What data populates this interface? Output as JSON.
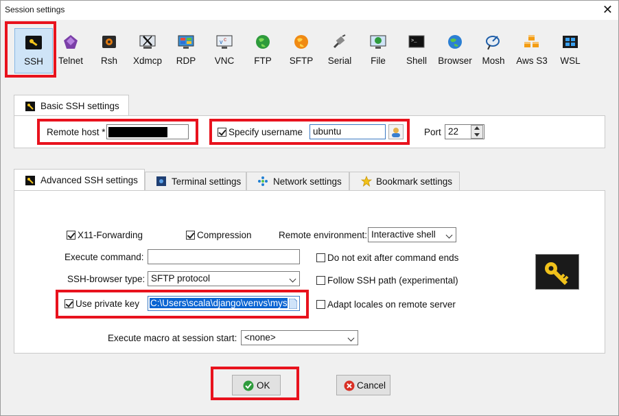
{
  "window": {
    "title": "Session settings",
    "close_glyph": "✕"
  },
  "protocols": [
    {
      "label": "SSH",
      "icon": "ssh-key-icon"
    },
    {
      "label": "Telnet",
      "icon": "telnet-icon"
    },
    {
      "label": "Rsh",
      "icon": "rsh-icon"
    },
    {
      "label": "Xdmcp",
      "icon": "xdmcp-icon"
    },
    {
      "label": "RDP",
      "icon": "rdp-monitor-icon"
    },
    {
      "label": "VNC",
      "icon": "vnc-icon"
    },
    {
      "label": "FTP",
      "icon": "ftp-globe-icon"
    },
    {
      "label": "SFTP",
      "icon": "sftp-globe-icon"
    },
    {
      "label": "Serial",
      "icon": "serial-plug-icon"
    },
    {
      "label": "File",
      "icon": "file-monitor-icon"
    },
    {
      "label": "Shell",
      "icon": "shell-terminal-icon"
    },
    {
      "label": "Browser",
      "icon": "browser-globe-icon"
    },
    {
      "label": "Mosh",
      "icon": "mosh-satellite-icon"
    },
    {
      "label": "Aws S3",
      "icon": "aws-s3-cubes-icon"
    },
    {
      "label": "WSL",
      "icon": "wsl-windows-icon"
    }
  ],
  "basic": {
    "tab_label": "Basic SSH settings",
    "remote_host_label": "Remote host *",
    "remote_host_value": "",
    "specify_username_label": "Specify username",
    "specify_username_checked": true,
    "username_value": "ubuntu",
    "port_label": "Port",
    "port_value": "22"
  },
  "tabs": [
    {
      "label": "Advanced SSH settings",
      "icon": "key-icon",
      "active": true
    },
    {
      "label": "Terminal settings",
      "icon": "terminal-icon",
      "active": false
    },
    {
      "label": "Network settings",
      "icon": "network-icon",
      "active": false
    },
    {
      "label": "Bookmark settings",
      "icon": "star-icon",
      "active": false
    }
  ],
  "advanced": {
    "x11_label": "X11-Forwarding",
    "x11_checked": true,
    "compression_label": "Compression",
    "compression_checked": true,
    "remote_env_label": "Remote environment:",
    "remote_env_value": "Interactive shell",
    "execute_command_label": "Execute command:",
    "execute_command_value": "",
    "do_not_exit_label": "Do not exit after command ends",
    "do_not_exit_checked": false,
    "browser_type_label": "SSH-browser type:",
    "browser_type_value": "SFTP protocol",
    "follow_ssh_label": "Follow SSH path (experimental)",
    "follow_ssh_checked": false,
    "private_key_label": "Use private key",
    "private_key_checked": true,
    "private_key_value": "C:\\Users\\scala\\django\\venvs\\mysit",
    "adapt_locales_label": "Adapt locales on remote server",
    "adapt_locales_checked": false,
    "macro_label": "Execute macro at session start:",
    "macro_value": "<none>"
  },
  "buttons": {
    "ok_label": "OK",
    "cancel_label": "Cancel"
  },
  "colors": {
    "highlight": "#e8121d",
    "selected_bg": "#cfe4f7",
    "selection": "#0a64d2"
  }
}
